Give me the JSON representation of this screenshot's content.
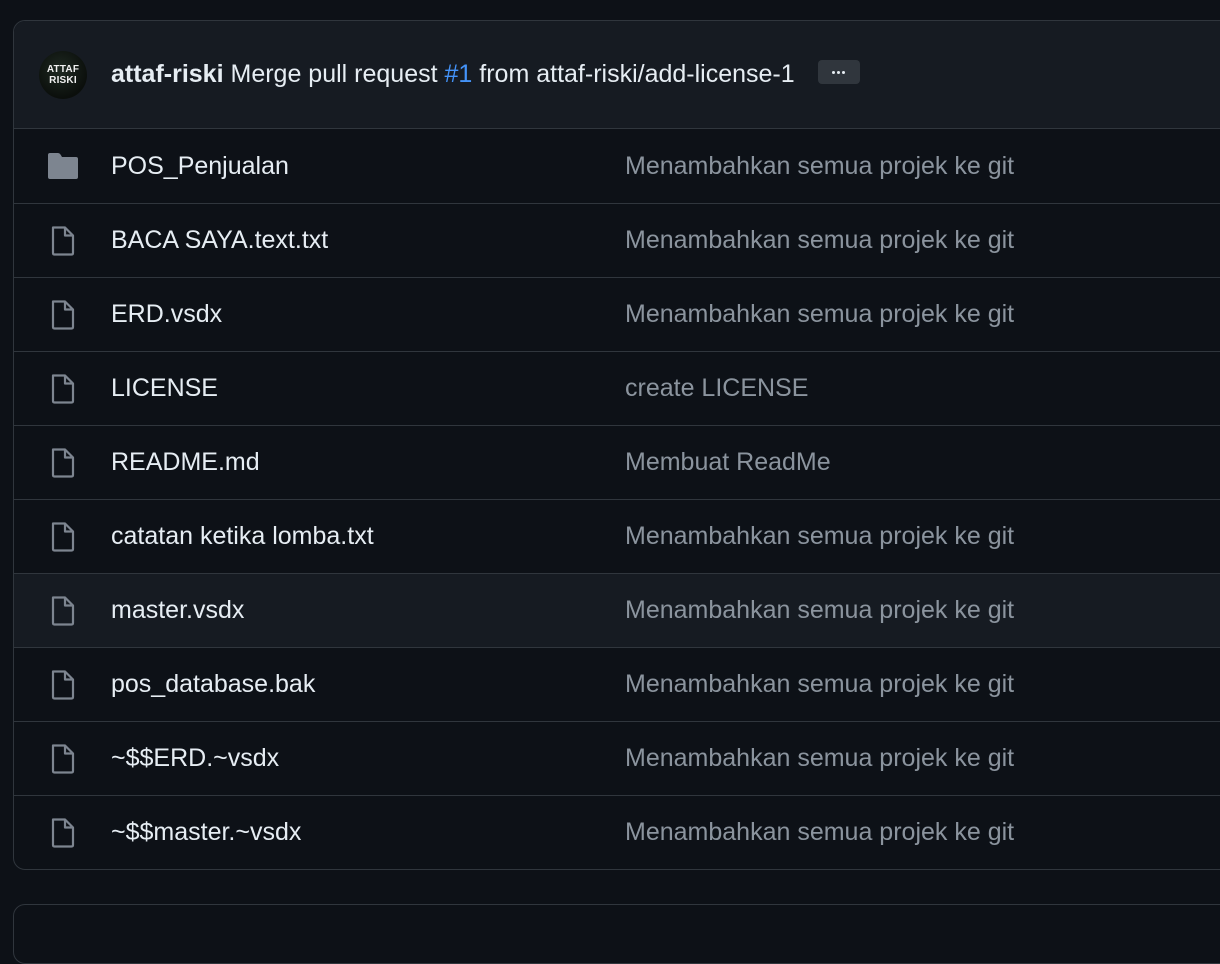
{
  "commit": {
    "avatar_line1": "ATTAF",
    "avatar_line2": "RISKI",
    "author": "attaf-riski",
    "message_prefix": "Merge pull request",
    "pr_link": "#1",
    "message_suffix": "from attaf-riski/add-license-1"
  },
  "files": [
    {
      "name": "POS_Penjualan",
      "type": "folder",
      "message": "Menambahkan semua projek ke git"
    },
    {
      "name": "BACA SAYA.text.txt",
      "type": "file",
      "message": "Menambahkan semua projek ke git"
    },
    {
      "name": "ERD.vsdx",
      "type": "file",
      "message": "Menambahkan semua projek ke git"
    },
    {
      "name": "LICENSE",
      "type": "file",
      "message": "create LICENSE"
    },
    {
      "name": "README.md",
      "type": "file",
      "message": "Membuat ReadMe"
    },
    {
      "name": "catatan ketika lomba.txt",
      "type": "file",
      "message": "Menambahkan semua projek ke git"
    },
    {
      "name": "master.vsdx",
      "type": "file",
      "message": "Menambahkan semua projek ke git"
    },
    {
      "name": "pos_database.bak",
      "type": "file",
      "message": "Menambahkan semua projek ke git"
    },
    {
      "name": "~$$ERD.~vsdx",
      "type": "file",
      "message": "Menambahkan semua projek ke git"
    },
    {
      "name": "~$$master.~vsdx",
      "type": "file",
      "message": "Menambahkan semua projek ke git"
    }
  ],
  "colors": {
    "background": "#0d1117",
    "header_background": "#161b22",
    "border": "#30363d",
    "link": "#4493f8",
    "muted_text": "#8b949e",
    "icon": "#7d8590"
  }
}
